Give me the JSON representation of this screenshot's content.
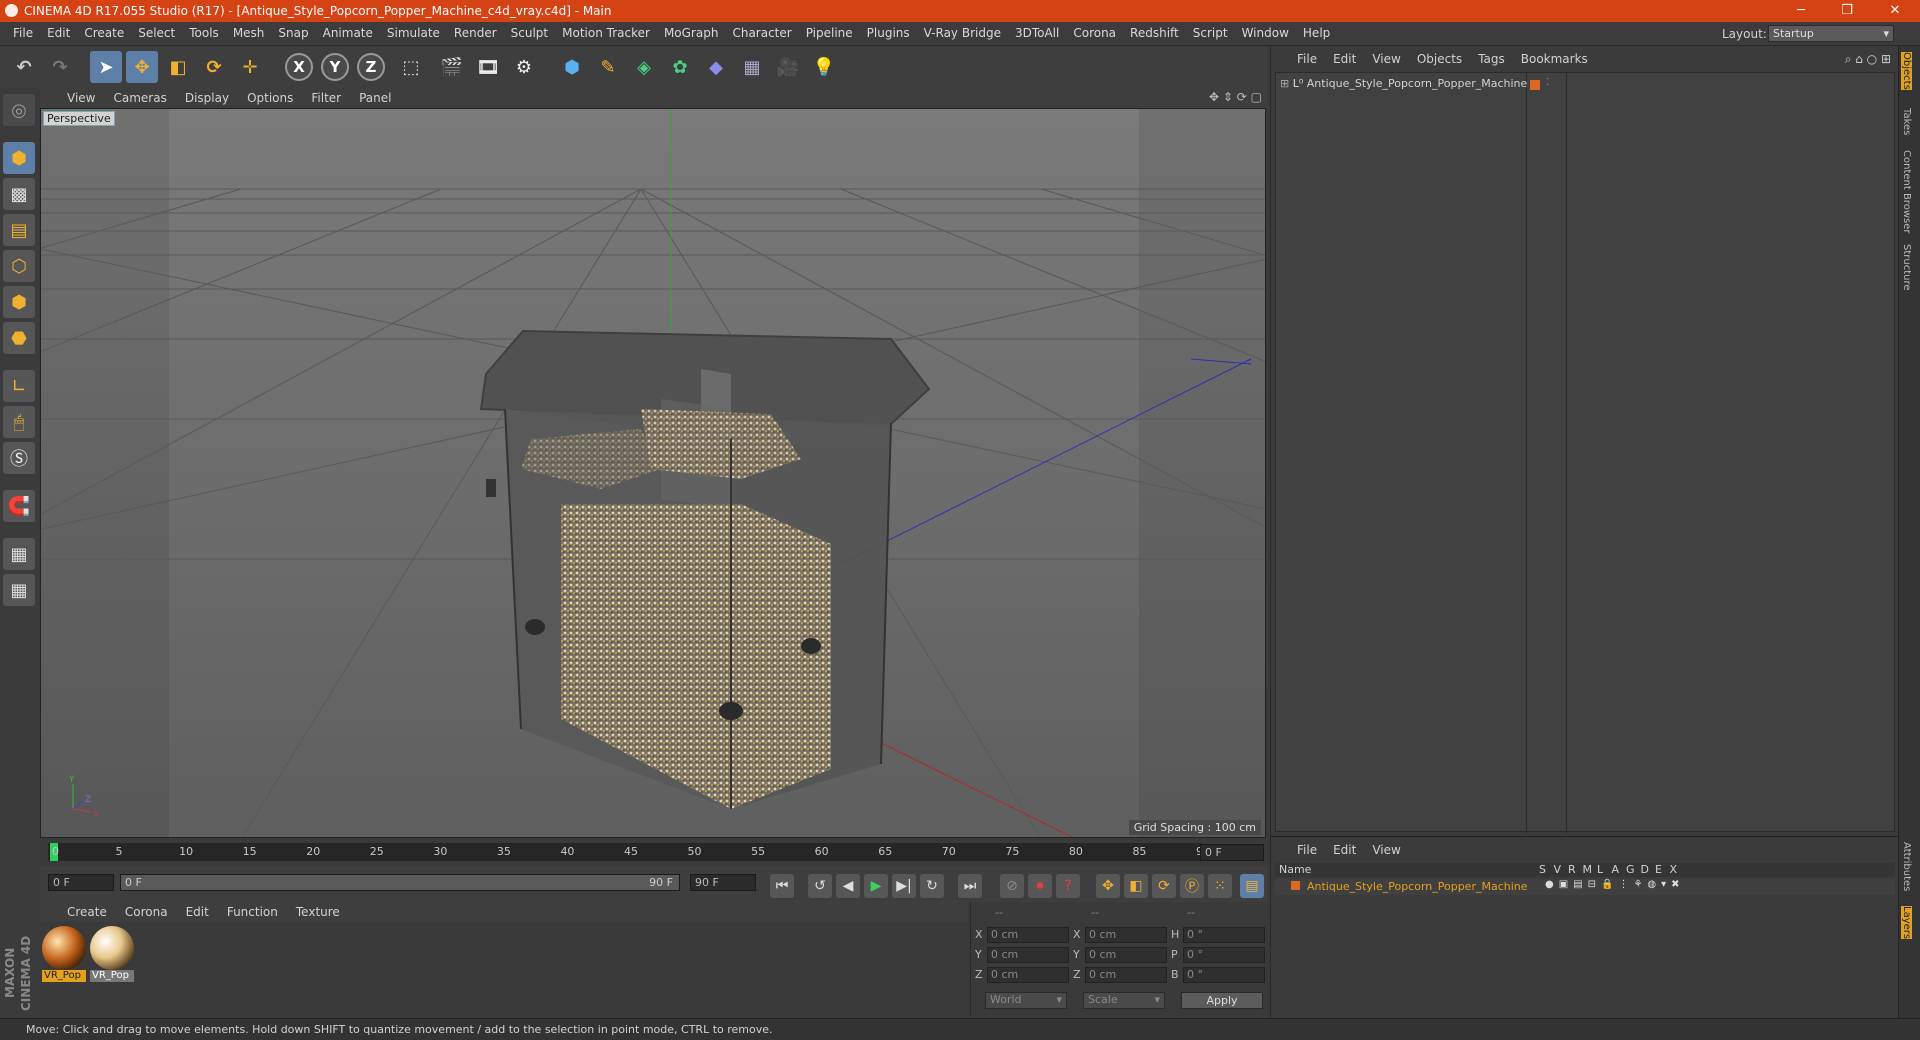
{
  "window": {
    "title": "CINEMA 4D R17.055 Studio (R17) - [Antique_Style_Popcorn_Popper_Machine_c4d_vray.c4d] - Main",
    "min": "─",
    "restore": "❐",
    "close": "✕"
  },
  "menu": [
    "File",
    "Edit",
    "Create",
    "Select",
    "Tools",
    "Mesh",
    "Snap",
    "Animate",
    "Simulate",
    "Render",
    "Sculpt",
    "Motion Tracker",
    "MoGraph",
    "Character",
    "Pipeline",
    "Plugins",
    "V-Ray Bridge",
    "3DToAll",
    "Corona",
    "Redshift",
    "Script",
    "Window",
    "Help"
  ],
  "layout": {
    "label": "Layout:",
    "value": "Startup"
  },
  "viewport_menu": [
    "View",
    "Cameras",
    "Display",
    "Options",
    "Filter",
    "Panel"
  ],
  "viewport": {
    "camera": "Perspective",
    "grid_spacing": "Grid Spacing : 100 cm"
  },
  "timeline": {
    "ticks": [
      "0",
      "5",
      "10",
      "15",
      "20",
      "25",
      "30",
      "35",
      "40",
      "45",
      "50",
      "55",
      "60",
      "65",
      "70",
      "75",
      "80",
      "85",
      "90"
    ],
    "current_frame": "0 F"
  },
  "playback": {
    "start": "0 F",
    "range_start": "0 F",
    "range_end": "90 F",
    "end": "90 F"
  },
  "material_menu": [
    "Create",
    "Corona",
    "Edit",
    "Function",
    "Texture"
  ],
  "materials": [
    {
      "name": "VR_Pop"
    },
    {
      "name": "VR_Pop"
    }
  ],
  "coords": {
    "headers": [
      "--",
      "--",
      "--"
    ],
    "rows": [
      {
        "a": "X",
        "v1": "0 cm",
        "b": "X",
        "v2": "0 cm",
        "c": "H",
        "v3": "0 °"
      },
      {
        "a": "Y",
        "v1": "0 cm",
        "b": "Y",
        "v2": "0 cm",
        "c": "P",
        "v3": "0 °"
      },
      {
        "a": "Z",
        "v1": "0 cm",
        "b": "Z",
        "v2": "0 cm",
        "c": "B",
        "v3": "0 °"
      }
    ],
    "space": "World",
    "mode": "Scale",
    "apply": "Apply"
  },
  "object_menu": [
    "File",
    "Edit",
    "View",
    "Objects",
    "Tags",
    "Bookmarks"
  ],
  "objects": [
    {
      "name": "Antique_Style_Popcorn_Popper_Machine"
    }
  ],
  "layer_menu": [
    "File",
    "Edit",
    "View"
  ],
  "layer_header": {
    "name": "Name",
    "cols": [
      "S",
      "V",
      "R",
      "M",
      "L",
      "A",
      "G",
      "D",
      "E",
      "X"
    ]
  },
  "layers": [
    {
      "name": "Antique_Style_Popcorn_Popper_Machine"
    }
  ],
  "side_tabs": [
    "Objects",
    "Takes",
    "Content Browser",
    "Structure"
  ],
  "side_tabs_bottom": [
    "Attributes",
    "Layers"
  ],
  "brand": "MAXON CINEMA 4D",
  "status": "Move: Click and drag to move elements. Hold down SHIFT to quantize movement / add to the selection in point mode, CTRL to remove.",
  "colors": {
    "title_bar": "#d54315",
    "accent": "#e2a21c",
    "selected": "#5d7fa8"
  }
}
